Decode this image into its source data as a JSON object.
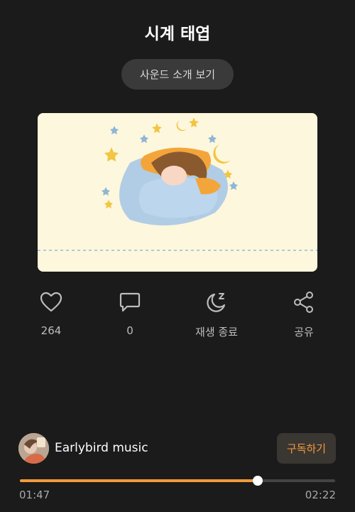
{
  "header": {
    "title": "시계 태엽"
  },
  "intro_button": {
    "label": "사운드 소개 보기"
  },
  "cover": {
    "alt_text": "Sleeping",
    "background": "#fdf7dd"
  },
  "actions": [
    {
      "icon": "heart-icon",
      "label": "264"
    },
    {
      "icon": "comment-icon",
      "label": "0"
    },
    {
      "icon": "sleep-timer-icon",
      "label": "재생 종료"
    },
    {
      "icon": "share-icon",
      "label": "공유"
    }
  ],
  "artist": {
    "name": "Earlybird music",
    "subscribe_label": "구독하기"
  },
  "player": {
    "current_time": "01:47",
    "total_time": "02:22",
    "progress_percent": 75.4
  },
  "colors": {
    "accent": "#f39a3b",
    "background": "#1b1b1b",
    "button_bg": "#3a3a3a"
  }
}
